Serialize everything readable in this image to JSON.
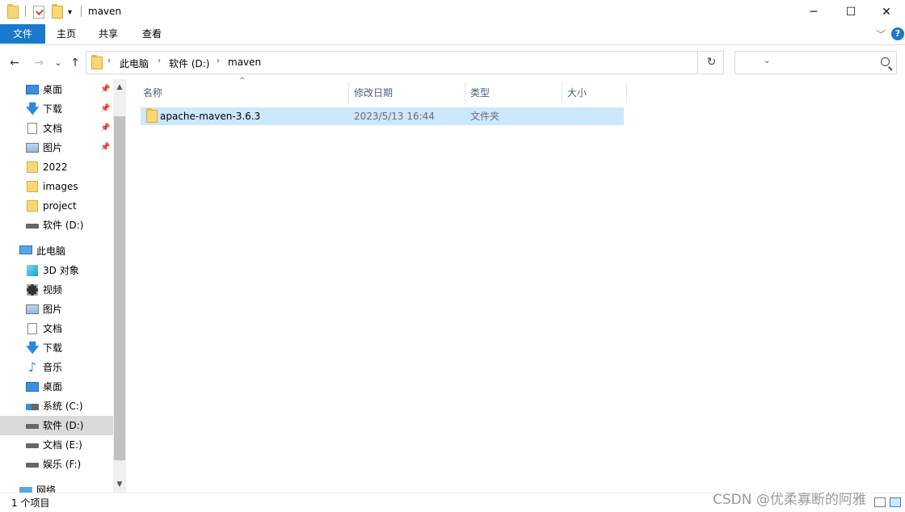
{
  "window": {
    "title": "maven",
    "minimize": "─",
    "maximize": "☐",
    "close": "✕"
  },
  "ribbon": {
    "tabs": [
      "文件",
      "主页",
      "共享",
      "查看"
    ],
    "expand_glyph": "﹀",
    "help_glyph": "?"
  },
  "nav": {
    "back": "←",
    "forward": "→",
    "recent": "⌄",
    "up": "↑",
    "breadcrumb": [
      "此电脑",
      "软件 (D:)",
      "maven"
    ],
    "chevron": "›",
    "dropdown": "⌄",
    "refresh": "↻",
    "search_placeholder": ""
  },
  "sidebar": {
    "quick_access": [
      {
        "label": "桌面",
        "icon": "desktop-icon",
        "pinned": true
      },
      {
        "label": "下载",
        "icon": "download-icon",
        "pinned": true
      },
      {
        "label": "文档",
        "icon": "document-icon",
        "pinned": true
      },
      {
        "label": "图片",
        "icon": "picture-icon",
        "pinned": true
      },
      {
        "label": "2022",
        "icon": "folder-icon",
        "pinned": false
      },
      {
        "label": "images",
        "icon": "folder-icon",
        "pinned": false
      },
      {
        "label": "project",
        "icon": "folder-icon",
        "pinned": false
      },
      {
        "label": "软件 (D:)",
        "icon": "drive-icon",
        "pinned": false
      }
    ],
    "this_pc": {
      "label": "此电脑",
      "icon": "computer-icon"
    },
    "pc_items": [
      {
        "label": "3D 对象",
        "icon": "3d-objects-icon"
      },
      {
        "label": "视频",
        "icon": "video-icon"
      },
      {
        "label": "图片",
        "icon": "picture-icon"
      },
      {
        "label": "文档",
        "icon": "document-icon"
      },
      {
        "label": "下载",
        "icon": "download-icon"
      },
      {
        "label": "音乐",
        "icon": "music-icon"
      },
      {
        "label": "桌面",
        "icon": "desktop-icon"
      },
      {
        "label": "系统 (C:)",
        "icon": "system-drive-icon"
      },
      {
        "label": "软件 (D:)",
        "icon": "drive-icon",
        "selected": true
      },
      {
        "label": "文档 (E:)",
        "icon": "drive-icon"
      },
      {
        "label": "娱乐 (F:)",
        "icon": "drive-icon"
      }
    ],
    "network": {
      "label": "网络",
      "icon": "network-icon"
    },
    "pin_glyph": "📌",
    "scroll_up": "▲",
    "scroll_down": "▼"
  },
  "content": {
    "sort_glyph": "^",
    "columns": [
      "名称",
      "修改日期",
      "类型",
      "大小"
    ],
    "rows": [
      {
        "name": "apache-maven-3.6.3",
        "modified": "2023/5/13 16:44",
        "type": "文件夹",
        "size": ""
      }
    ]
  },
  "status": {
    "count": "1 个项目"
  },
  "watermark": "CSDN @优柔寡断的阿雅"
}
